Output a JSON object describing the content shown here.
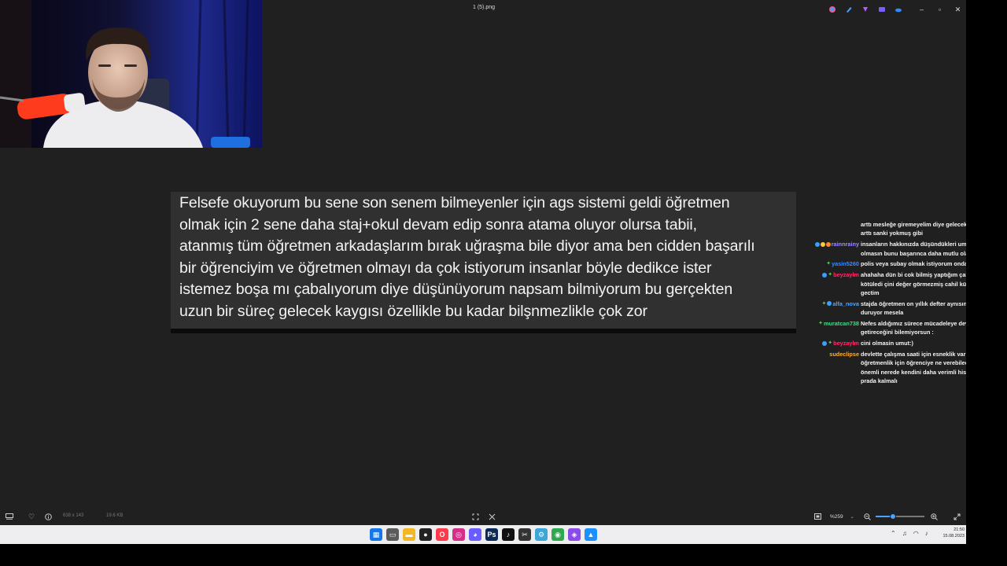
{
  "window": {
    "title": "1 (5).png"
  },
  "message": {
    "lines": [
      "Felsefe okuyorum bu sene son senem bilmeyenler için ags sistemi geldi öğretmen",
      "olmak için 2 sene daha staj+okul devam edip sonra atama oluyor olursa tabii,",
      "atanmış tüm öğretmen arkadaşlarım bırak uğraşma bile diyor ama ben cidden başarılı",
      "bir öğrenciyim ve öğretmen olmayı da çok istiyorum insanlar böyle dedikce ister",
      "istemez boşa mı çabalıyorum diye düşünüyorum napsam bilmiyorum bu gerçekten",
      "uzun bir süreç gelecek kaygısı özellikle bu kadar bilşnmezlikle çok zor"
    ]
  },
  "chat": [
    {
      "user": "",
      "color": "#ffffff",
      "badges": [],
      "text": "arttı mesleğe giremeyelim diye gelecek kaygısı iyice arttı sanki yokmuş gibi"
    },
    {
      "user": "rainnrainy",
      "color": "#9b8cff",
      "badges": [
        "#3aa0ff",
        "#ffc93a",
        "#ff8c2a"
      ],
      "text": "insanların hakkınızda düşündükleri umrunuzda olmasın bunu başarınca daha mutlu olacaksınız"
    },
    {
      "user": "yasin5260",
      "color": "#3b8bff",
      "badges": [
        "star"
      ],
      "text": "polis veya subay olmak istiyorum ondan sordum"
    },
    {
      "user": "beyzaylm",
      "color": "#ff2d6a",
      "badges": [
        "#3aa0ff",
        "star"
      ],
      "text": "ahahaha dün bi cok bilmiş yaptığım çalışanları kötüledi çini değer görmezmiş cahil kühela dedim gectim"
    },
    {
      "user": "alfa_nova",
      "color": "#4fa3ff",
      "badges": [
        "star",
        "#3aa0ff"
      ],
      "text": "stajda öğretmen on yıllık defter aynısını anlatıp duruyor mesela"
    },
    {
      "user": "muratcan738",
      "color": "#3fdd8a",
      "badges": [
        "star"
      ],
      "text": "Nefes aldığımız sürece mücadeleye devam hayatın ne getireceğini bilemiyorsun :"
    },
    {
      "user": "beyzaylm",
      "color": "#ff2d6a",
      "badges": [
        "#3aa0ff",
        "star"
      ],
      "text": "cini olmasin umut:)"
    },
    {
      "user": "sudeclipse",
      "color": "#ffb02e",
      "badges": [],
      "text": "devlette çalışma saati için esneklik var ama öğretmenlik için öğrenciye ne verebileceğin daha önemli nerede kendini daha verimli hissedecekse prada kalmalı"
    }
  ],
  "bottombar": {
    "dimensions": "638 x 143",
    "filesize": "19.6 KB",
    "zoom": "%259",
    "zoom_fraction": 0.35
  },
  "taskbar": {
    "time": "21:50",
    "date": "15.08.2023"
  },
  "colors": {
    "viewer_bg": "#202020",
    "message_bg": "#303030",
    "taskbar_bg": "#eeeef0",
    "accent": "#4aa3ff"
  }
}
